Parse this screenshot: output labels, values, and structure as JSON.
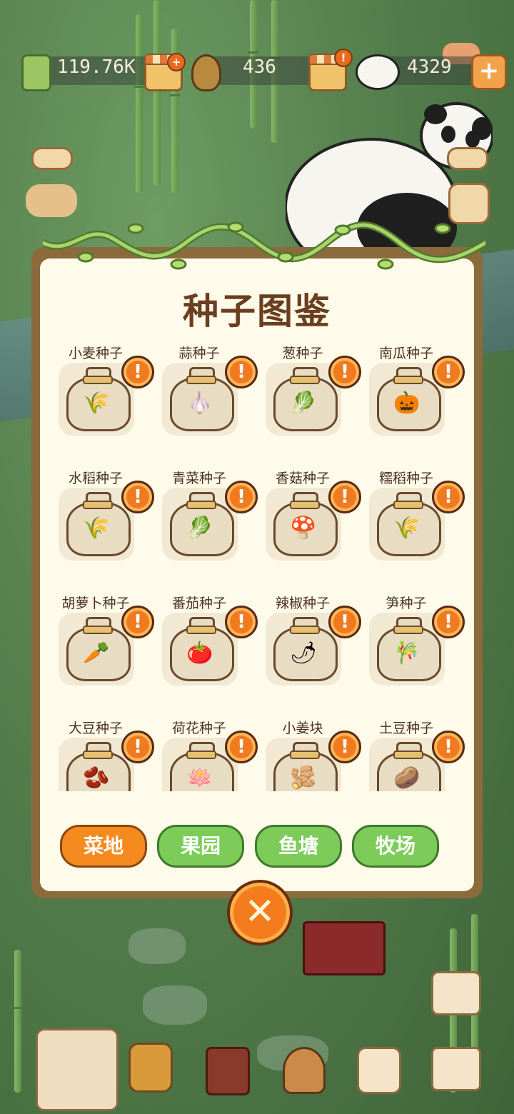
{
  "resources": {
    "bamboo_amount": "119.76K",
    "shoot_amount": "436",
    "panda_amount": "4329"
  },
  "dialog": {
    "title": "种子图鉴",
    "seeds": [
      {
        "label": "小麦种子",
        "icon": "wheat-icon"
      },
      {
        "label": "蒜种子",
        "icon": "garlic-icon"
      },
      {
        "label": "葱种子",
        "icon": "scallion-icon"
      },
      {
        "label": "南瓜种子",
        "icon": "pumpkin-icon"
      },
      {
        "label": "水稻种子",
        "icon": "rice-icon"
      },
      {
        "label": "青菜种子",
        "icon": "greens-icon"
      },
      {
        "label": "香菇种子",
        "icon": "mushroom-icon"
      },
      {
        "label": "糯稻种子",
        "icon": "glutinous-rice-icon"
      },
      {
        "label": "胡萝卜种子",
        "icon": "carrot-icon"
      },
      {
        "label": "番茄种子",
        "icon": "tomato-icon"
      },
      {
        "label": "辣椒种子",
        "icon": "chili-icon"
      },
      {
        "label": "笋种子",
        "icon": "bamboo-shoot-icon"
      },
      {
        "label": "大豆种子",
        "icon": "soybean-icon"
      },
      {
        "label": "荷花种子",
        "icon": "lotus-icon"
      },
      {
        "label": "小姜块",
        "icon": "ginger-icon"
      },
      {
        "label": "土豆种子",
        "icon": "potato-icon"
      }
    ],
    "alert_glyph": "!",
    "tabs": [
      {
        "label": "菜地",
        "active": true
      },
      {
        "label": "果园",
        "active": false
      },
      {
        "label": "鱼塘",
        "active": false
      },
      {
        "label": "牧场",
        "active": false
      }
    ],
    "close_glyph": "✕"
  },
  "top_plus_glyph": "+",
  "badge_glyph": "!",
  "colors": {
    "panel": "#fffbea",
    "title": "#6a3e1e",
    "active_tab": "#f58b1f",
    "inactive_tab": "#7dcc5a",
    "alert": "#f07a20"
  }
}
